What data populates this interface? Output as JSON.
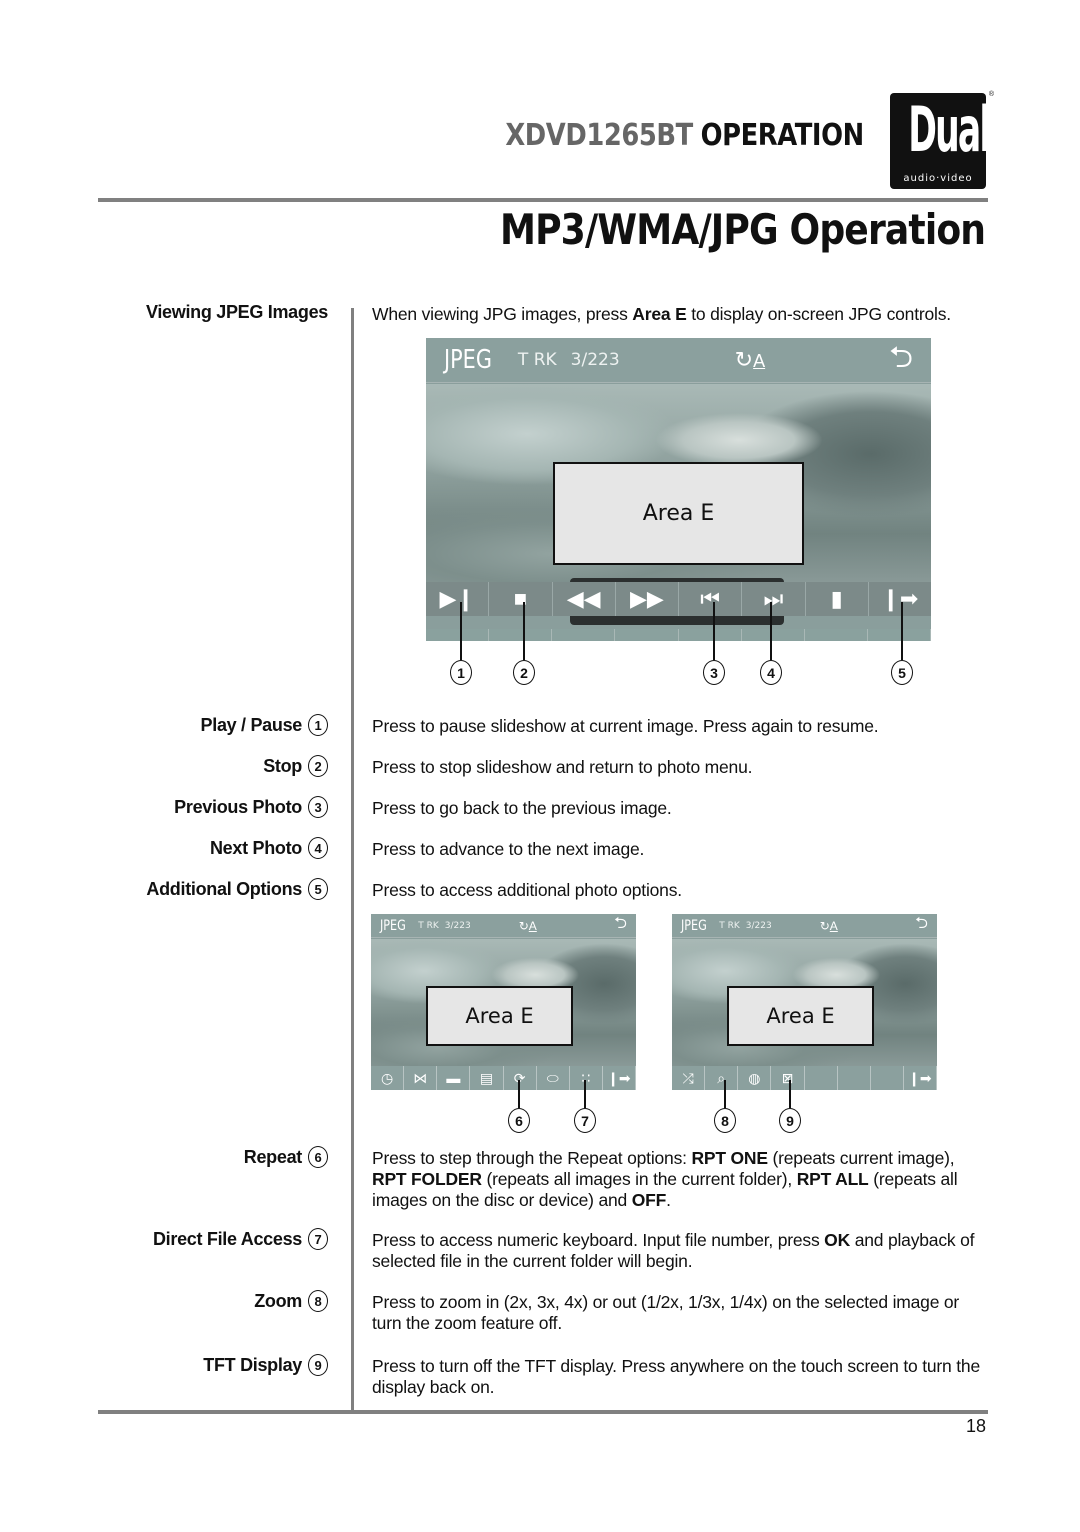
{
  "header": {
    "model": "XDVD1265BT",
    "operation": "OPERATION",
    "logo_word": "Dual",
    "logo_sub": "audio·video",
    "logo_reg": "®",
    "page_title": "MP3/WMA/JPG Operation"
  },
  "section": {
    "label": "Viewing JPEG Images",
    "intro_pre": "When viewing JPG images, press ",
    "intro_bold": "Area E",
    "intro_post": " to display on-screen JPG controls."
  },
  "screen": {
    "mode": "JPEG",
    "trk_label": "T RK",
    "track": "3/223",
    "repeat_icon": "repeat-all-icon",
    "back_icon": "back-arrow-icon",
    "area_label": "Area E",
    "controls": [
      {
        "icon": "play-pause-icon",
        "glyph": "▶❙",
        "callout": "1"
      },
      {
        "icon": "stop-icon",
        "glyph": "■",
        "callout": "2"
      },
      {
        "icon": "rewind-icon",
        "glyph": "◀◀",
        "callout": ""
      },
      {
        "icon": "fast-forward-icon",
        "glyph": "▶▶",
        "callout": ""
      },
      {
        "icon": "previous-track-icon",
        "glyph": "⏮",
        "callout": "3"
      },
      {
        "icon": "next-track-icon",
        "glyph": "⏭",
        "callout": "4"
      },
      {
        "icon": "volume-icon",
        "glyph": "▮",
        "callout": ""
      },
      {
        "icon": "more-options-icon",
        "glyph": "❙➡",
        "callout": "5"
      }
    ]
  },
  "small_screens": [
    {
      "controls": [
        {
          "icon": "clock-icon",
          "glyph": "◷"
        },
        {
          "icon": "aspect-ratio-icon",
          "glyph": "⋈"
        },
        {
          "icon": "folder-icon",
          "glyph": "▬"
        },
        {
          "icon": "file-list-icon",
          "glyph": "▤"
        },
        {
          "icon": "repeat-icon",
          "glyph": "⟳",
          "callout": "6"
        },
        {
          "icon": "direct-access-icon",
          "glyph": "⬭"
        },
        {
          "icon": "keypad-icon",
          "glyph": "∷",
          "callout": "7"
        },
        {
          "icon": "more-options-icon",
          "glyph": "❙➡"
        }
      ]
    },
    {
      "controls": [
        {
          "icon": "shuffle-icon",
          "glyph": "⤮"
        },
        {
          "icon": "zoom-icon",
          "glyph": "⌕",
          "callout": "8"
        },
        {
          "icon": "globe-search-icon",
          "glyph": "◍"
        },
        {
          "icon": "tft-off-icon",
          "glyph": "⊠",
          "callout": "9"
        },
        {
          "icon": "empty-slot",
          "glyph": ""
        },
        {
          "icon": "empty-slot",
          "glyph": ""
        },
        {
          "icon": "empty-slot",
          "glyph": ""
        },
        {
          "icon": "more-options-icon",
          "glyph": "❙➡"
        }
      ]
    }
  ],
  "items": [
    {
      "label": "Play / Pause",
      "num": "1",
      "desc": "Press to pause slideshow at current image. Press again to resume."
    },
    {
      "label": "Stop",
      "num": "2",
      "desc": "Press to stop slideshow and return to photo menu."
    },
    {
      "label": "Previous Photo",
      "num": "3",
      "desc": "Press to go back to the previous image."
    },
    {
      "label": "Next Photo",
      "num": "4",
      "desc": "Press to advance to the next image."
    },
    {
      "label": "Additional Options",
      "num": "5",
      "desc": "Press to access additional photo options."
    },
    {
      "label": "Repeat",
      "num": "6",
      "desc_parts": [
        "Press to step through the Repeat options: ",
        "RPT ONE",
        " (repeats current image), ",
        "RPT FOLDER",
        " (repeats all images in the current folder), ",
        "RPT ALL",
        " (repeats all images on the disc or device) and ",
        "OFF",
        "."
      ]
    },
    {
      "label": "Direct File Access",
      "num": "7",
      "desc_parts": [
        "Press to access numeric keyboard. Input file number, press ",
        "OK",
        " and playback of selected file in the current folder will begin."
      ]
    },
    {
      "label": "Zoom",
      "num": "8",
      "desc": "Press to zoom in (2x, 3x, 4x) or out (1/2x, 1/3x, 1/4x) on the selected image or turn the zoom feature off."
    },
    {
      "label": "TFT Display",
      "num": "9",
      "desc": "Press to turn off the TFT display. Press anywhere on the touch screen to turn the display back on."
    }
  ],
  "page_number": "18"
}
